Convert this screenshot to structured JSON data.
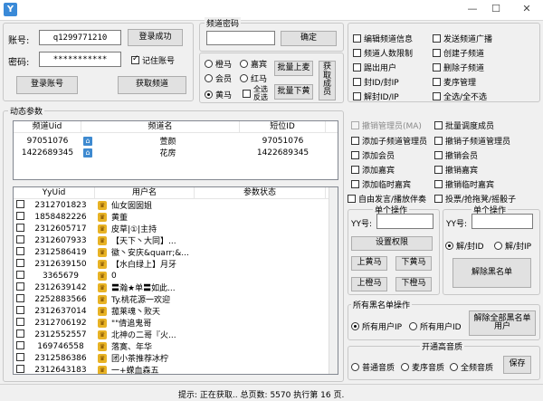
{
  "titlebar": {
    "min": "—",
    "max": "☐",
    "close": "✕"
  },
  "login": {
    "account_label": "账号:",
    "account_value": "q1299771210",
    "password_label": "密码:",
    "password_value": "***********",
    "login_success_btn": "登录成功",
    "remember_label": "记住账号",
    "login_account_btn": "登录账号",
    "get_channel_btn": "获取频道"
  },
  "channel_pwd": {
    "title": "频道密码",
    "confirm_btn": "确定"
  },
  "mic": {
    "opts": [
      "橙马",
      "嘉宾",
      "会员",
      "红马",
      "黄马"
    ],
    "allpass_label": "全选 反选",
    "batch_up_btn": "批量上麦",
    "batch_down_btn": "批量下黄",
    "get_members_btn": "获取成员"
  },
  "perms_top": [
    "编辑频道信息",
    "发送频道广播",
    "频道人数限制",
    "创建子频道",
    "踢出用户",
    "删除子频道",
    "封ID/封IP",
    "麦序管理",
    "解封ID/IP",
    "全选/全不选"
  ],
  "dynamic": {
    "title": "动态参数"
  },
  "channel_list": {
    "headers": [
      "频道Uid",
      "频道名",
      "短位ID"
    ],
    "rows": [
      {
        "uid": "97051076",
        "name": "萱颜",
        "short": "97051076"
      },
      {
        "uid": "1422689345",
        "name": "花房",
        "short": "1422689345"
      }
    ]
  },
  "perms_mid": [
    "撤销管理员(MA)",
    "批量调度成员",
    "添加子频道管理员",
    "撤销子频道管理员",
    "添加会员",
    "撤销会员",
    "添加嘉宾",
    "撤销嘉宾",
    "添加临时嘉宾",
    "撤销临时嘉宾"
  ],
  "free_speak_label": "自由发言/播放伴奏",
  "vote_label": "投票/抢拖凳/摇骰子",
  "user_list": {
    "headers": [
      "YyUid",
      "用户名",
      "参数状态"
    ],
    "rows": [
      {
        "uid": "2312701823",
        "name": "仙女囡囡姐"
      },
      {
        "uid": "1858482226",
        "name": "黄董"
      },
      {
        "uid": "2312605717",
        "name": "皮草|①|主持"
      },
      {
        "uid": "2312607933",
        "name": "【天下丶大同】..."
      },
      {
        "uid": "2312586419",
        "name": "徽丶安庆&quarr;&..."
      },
      {
        "uid": "2312639150",
        "name": "【水白绿上】月牙"
      },
      {
        "uid": "3365679",
        "name": "0"
      },
      {
        "uid": "2312639142",
        "name": "〓瀚★单〓如此..."
      },
      {
        "uid": "2252883566",
        "name": "Ty.桃花源一欢迎"
      },
      {
        "uid": "2312637014",
        "name": "菰莱魂丶败天"
      },
      {
        "uid": "2312706192",
        "name": "\"\"倩追鬼哥"
      },
      {
        "uid": "2312552557",
        "name": "北神の二哥『火..."
      },
      {
        "uid": "169746558",
        "name": "落寞、年华"
      },
      {
        "uid": "2312586386",
        "name": "团小茶推荐冰柠"
      },
      {
        "uid": "2312643183",
        "name": "一+蝾血森五"
      }
    ]
  },
  "single_left": {
    "title": "单个操作",
    "yy_label": "YY号:",
    "set_perm_btn": "设置权限",
    "up_yellow_btn": "上黄马",
    "down_yellow_btn": "下黄马",
    "up_orange_btn": "上橙马",
    "down_orange_btn": "下橙马"
  },
  "single_right": {
    "title": "单个操作",
    "yy_label": "YY号:",
    "unban_id_label": "解/封ID",
    "unban_ip_label": "解/封IP",
    "unban_blacklist_btn": "解除黑名单"
  },
  "blacklist": {
    "title": "所有黑名单操作",
    "all_ip_label": "所有用户IP",
    "all_id_label": "所有用户ID",
    "unban_all_btn": "解除全部黑名单用户"
  },
  "quality": {
    "title": "开通高音质",
    "opts": [
      "普通音质",
      "麦序音质",
      "全频音质"
    ],
    "save_btn": "保存"
  },
  "status": {
    "hint_label": "提示:",
    "hint_text": "正在获取..",
    "total_label": "总页数:",
    "total_value": "5570",
    "exec_label": "执行第",
    "exec_value": "16",
    "page_label": "页."
  }
}
